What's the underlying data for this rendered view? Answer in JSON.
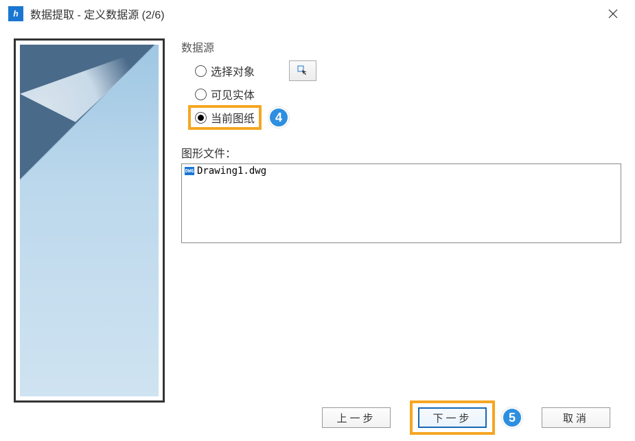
{
  "titlebar": {
    "title": "数据提取 - 定义数据源 (2/6)"
  },
  "dataSource": {
    "groupLabel": "数据源",
    "options": {
      "selectObjects": "选择对象",
      "visibleEntities": "可见实体",
      "currentDrawing": "当前图纸"
    }
  },
  "files": {
    "label": "图形文件：",
    "items": [
      "Drawing1.dwg"
    ]
  },
  "buttons": {
    "prev": "上一步",
    "next": "下一步",
    "cancel": "取消"
  },
  "callouts": {
    "four": "4",
    "five": "5"
  }
}
